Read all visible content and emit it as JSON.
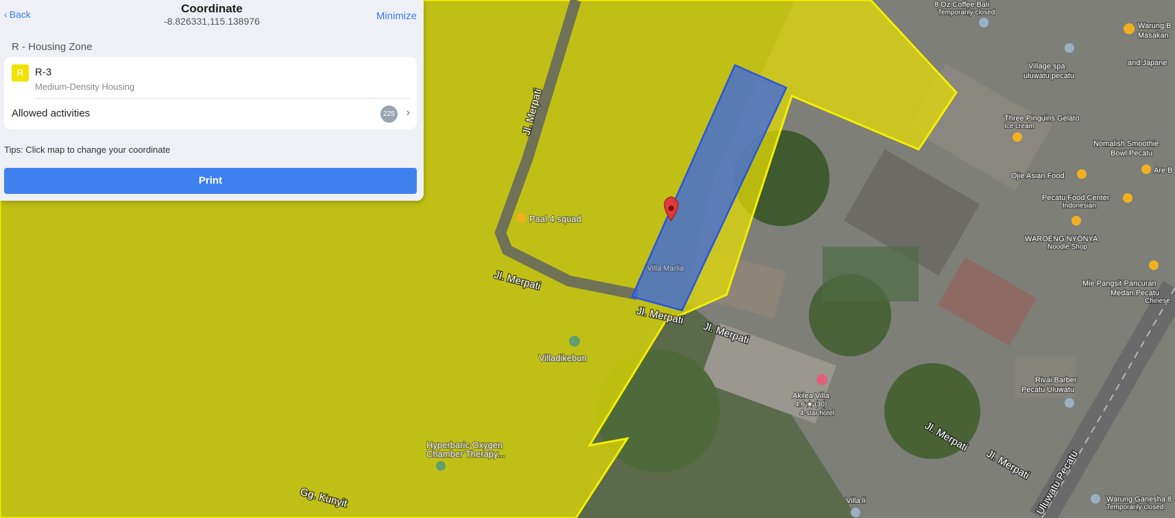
{
  "panel": {
    "back_label": "Back",
    "title": "Coordinate",
    "coordinates": "-8.826331,115.138976",
    "minimize_label": "Minimize",
    "zone_header": "R - Housing Zone",
    "zone_badge": "R",
    "zone_code": "R-3",
    "zone_description": "Medium-Density Housing",
    "allowed_label": "Allowed activities",
    "allowed_count": "225",
    "tips": "Tips: Click map to change your coordinate",
    "print_label": "Print"
  },
  "map": {
    "colors": {
      "zone_fill": "#e8e000",
      "zone_border": "#f5ef00",
      "parcel_fill": "#3c68e0",
      "pin": "#e03a3a"
    },
    "places": [
      {
        "name": "8 Oz Coffee Bali",
        "sub": "Temporarily closed"
      },
      {
        "name": "Warung B",
        "sub": ""
      },
      {
        "name": "Masakan",
        "sub": ""
      },
      {
        "name": "Village spa",
        "sub": ""
      },
      {
        "name": "uluwatu pecatu",
        "sub": ""
      },
      {
        "name": "and Japane",
        "sub": ""
      },
      {
        "name": "Three Pinguins Gelato",
        "sub": "Ice cream"
      },
      {
        "name": "Nomalish Smoothie",
        "sub": ""
      },
      {
        "name": "Bowl Pecatu",
        "sub": ""
      },
      {
        "name": "Ojie Asian Food",
        "sub": ""
      },
      {
        "name": "Are B",
        "sub": ""
      },
      {
        "name": "Pecatu Food Center",
        "sub": "Indonesian"
      },
      {
        "name": "WAROENG NYONYA",
        "sub": "Noodle Shop"
      },
      {
        "name": "Mie Pangsit Pancuran",
        "sub": ""
      },
      {
        "name": "Medan Pecatu",
        "sub": "Chinese"
      },
      {
        "name": "Paal 4 squad",
        "sub": ""
      },
      {
        "name": "Villa Marlia",
        "sub": ""
      },
      {
        "name": "Villadikebun",
        "sub": ""
      },
      {
        "name": "Akilea Villa",
        "sub": "4.6 ★ (30)"
      },
      {
        "name": "4-star hotel",
        "sub": ""
      },
      {
        "name": "Hyperbaric Oxygen",
        "sub": ""
      },
      {
        "name": "Chamber Therapy...",
        "sub": ""
      },
      {
        "name": "Rivai Barber",
        "sub": ""
      },
      {
        "name": "Pecatu Uluwatu",
        "sub": ""
      },
      {
        "name": "Warung Ganesha 8",
        "sub": "Temporarily closed"
      },
      {
        "name": "Villa li",
        "sub": ""
      }
    ],
    "roads": [
      "Jl. Merpati",
      "Jl. Merpati",
      "Jl. Merpati",
      "Jl. Merpati",
      "Jl. Merpati",
      "Jl. Merpati",
      "Gg. Kunyit",
      "Uluwatu Pecatu"
    ]
  }
}
